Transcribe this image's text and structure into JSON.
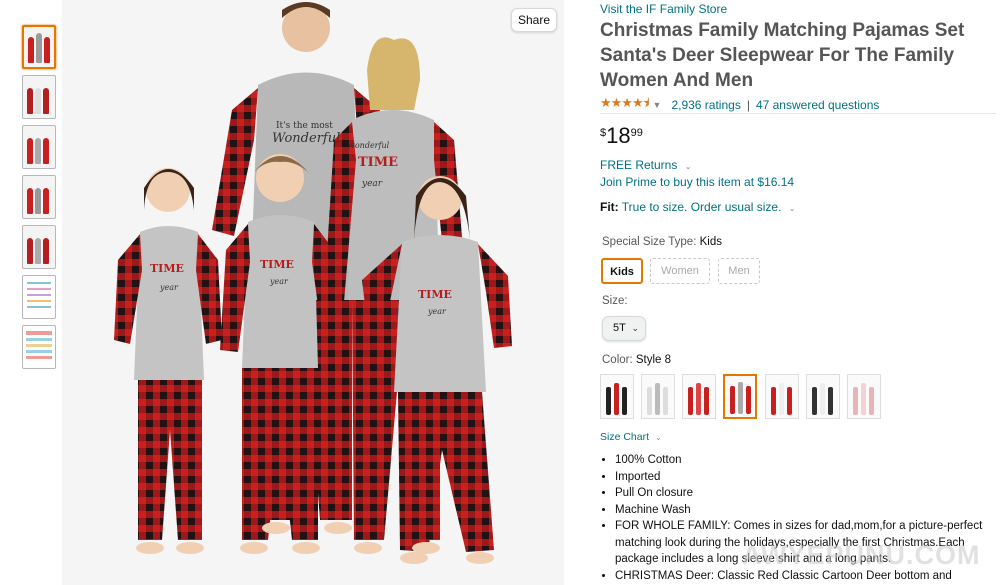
{
  "share_label": "Share",
  "store_link": "Visit the IF Family Store",
  "title": "Christmas Family Matching Pajamas Set Santa's Deer Sleepwear For The Family Women And Men",
  "rating": {
    "stars": "★★★★⯨",
    "ratings": "2,936 ratings",
    "separator": "|",
    "questions": "47 answered questions"
  },
  "price": {
    "symbol": "$",
    "whole": "18",
    "fraction": "99"
  },
  "free_returns": "FREE Returns",
  "prime_offer": "Join Prime to buy this item at $16.14",
  "fit": {
    "label": "Fit:",
    "text": "True to size. Order usual size."
  },
  "size_type": {
    "label": "Special Size Type:",
    "value": "Kids",
    "options": [
      "Kids",
      "Women",
      "Men"
    ]
  },
  "size": {
    "label": "Size:",
    "value": "5T"
  },
  "color": {
    "label": "Color:",
    "value": "Style 8"
  },
  "size_chart": "Size Chart",
  "bullets": [
    "100% Cotton",
    "Imported",
    "Pull On closure",
    "Machine Wash",
    "FOR WHOLE FAMILY: Comes in sizes for dad,mom,for a picture-perfect matching look during the holidays,especially the first Christmas.Each package includes a long sleeve shirt and a long pants.",
    "CHRISTMAS Deer: Classic Red Classic Cartoon Deer bottom and matching"
  ],
  "shirt_text": "It's the most Wonderful TIME of the year",
  "watermark": "AWYEPUNU.COM",
  "colors": {
    "accent": "#e77600",
    "link": "#007185",
    "star": "#de7921",
    "plaid_red": "#c8201e",
    "plaid_dark": "#2a1416",
    "shirt_gray": "#bdbdbd"
  }
}
